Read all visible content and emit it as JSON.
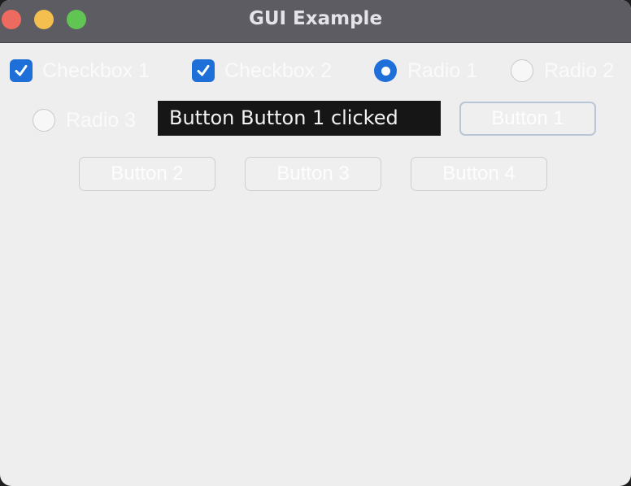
{
  "window": {
    "title": "GUI Example"
  },
  "controls": {
    "checkbox1": {
      "label": "Checkbox 1",
      "checked": true
    },
    "checkbox2": {
      "label": "Checkbox 2",
      "checked": true
    },
    "radio1": {
      "label": "Radio 1",
      "selected": true
    },
    "radio2": {
      "label": "Radio 2",
      "selected": false
    },
    "radio3": {
      "label": "Radio 3",
      "selected": false
    }
  },
  "status_text": "Button Button 1 clicked",
  "buttons": {
    "button1": "Button 1",
    "button2": "Button 2",
    "button3": "Button 3",
    "button4": "Button 4"
  },
  "colors": {
    "accent": "#1f6fd9",
    "titlebar": "#5e5c63",
    "background": "#eeeeee",
    "status_background": "#161616"
  }
}
